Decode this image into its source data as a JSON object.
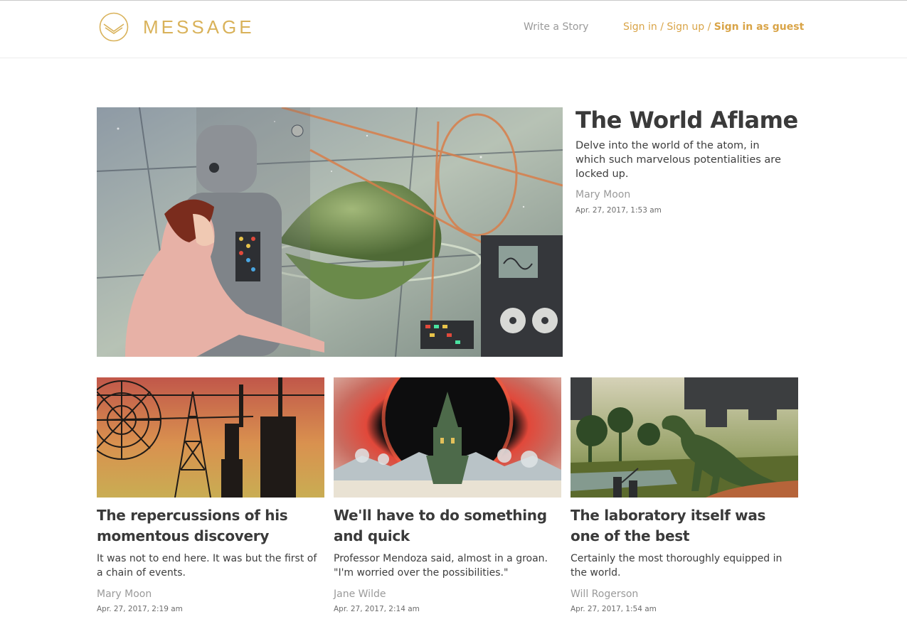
{
  "brand": {
    "name": "MESSAGE",
    "logo_icon": "envelope-circle-icon",
    "accent": "#d9b25a"
  },
  "nav": {
    "write": "Write a Story",
    "sign_in": "Sign in",
    "sep": " / ",
    "sign_up": "Sign up",
    "guest": "Sign in as guest"
  },
  "featured": {
    "title": "The World Aflame",
    "description": "Delve into the world of the atom, in which such marvelous potentialities are locked up.",
    "author": "Mary Moon",
    "date": "Apr. 27, 2017, 1:53 am"
  },
  "stories": [
    {
      "title": "The repercussions of his momentous discovery",
      "description": "It was not to end here. It was but the first of a chain of events.",
      "author": "Mary Moon",
      "date": "Apr. 27, 2017, 2:19 am"
    },
    {
      "title": "We'll have to do something and quick",
      "description": "Professor Mendoza said, almost in a groan. \"I'm worried over the possibilities.\"",
      "author": "Jane Wilde",
      "date": "Apr. 27, 2017, 2:14 am"
    },
    {
      "title": "The laboratory itself was one of the best",
      "description": "Certainly the most thoroughly equipped in the world.",
      "author": "Will Rogerson",
      "date": "Apr. 27, 2017, 1:54 am"
    }
  ]
}
